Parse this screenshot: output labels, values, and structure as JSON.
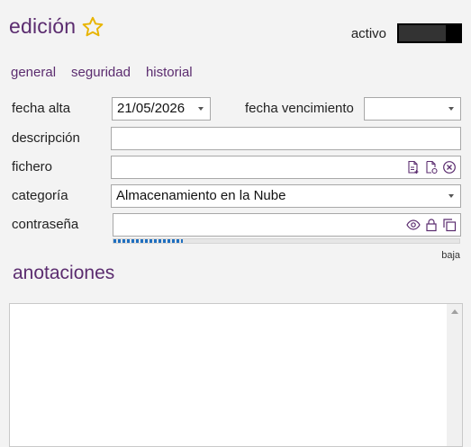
{
  "header": {
    "title": "edición",
    "active_label": "activo",
    "active_toggle_on": true
  },
  "tabs": [
    {
      "label": "general"
    },
    {
      "label": "seguridad"
    },
    {
      "label": "historial"
    }
  ],
  "form": {
    "fecha_alta_label": "fecha alta",
    "fecha_alta_value": "21/05/2026",
    "fecha_vencimiento_label": "fecha vencimiento",
    "fecha_vencimiento_value": "",
    "descripcion_label": "descripción",
    "descripcion_value": "",
    "fichero_label": "fichero",
    "fichero_value": "",
    "categoria_label": "categoría",
    "categoria_value": "Almacenamiento en la Nube",
    "contrasena_label": "contraseña",
    "contrasena_value": "",
    "strength_fraction": 0.2,
    "strength_label": "baja"
  },
  "notes": {
    "title": "anotaciones",
    "value": ""
  },
  "colors": {
    "accent": "#5b2c6f",
    "star": "#e8b400",
    "strength": "#1f6fbf"
  },
  "icons": {
    "favorite": "star-icon",
    "fichero_actions": [
      "new-document-icon",
      "open-document-icon",
      "clear-icon"
    ],
    "contrasena_actions": [
      "eye-icon",
      "lock-icon",
      "copy-icon"
    ]
  }
}
